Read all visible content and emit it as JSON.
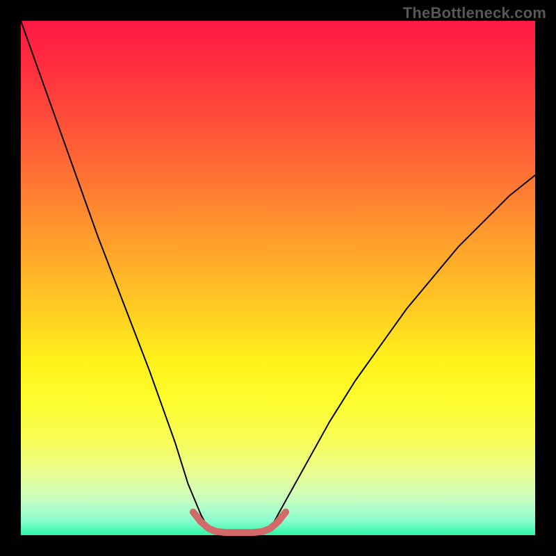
{
  "watermark": "TheBottleneck.com",
  "chart_data": {
    "type": "line",
    "title": "",
    "xlabel": "",
    "ylabel": "",
    "xlim": [
      0,
      100
    ],
    "ylim": [
      0,
      100
    ],
    "grid": false,
    "legend": false,
    "series": [
      {
        "name": "left-curve",
        "x": [
          0,
          5,
          10,
          15,
          20,
          25,
          30,
          32.5,
          35,
          36.5
        ],
        "y": [
          100,
          86,
          72,
          58,
          45,
          32,
          18,
          10,
          4,
          1.2
        ]
      },
      {
        "name": "right-curve",
        "x": [
          48.5,
          50,
          55,
          60,
          65,
          70,
          75,
          80,
          85,
          90,
          95,
          100
        ],
        "y": [
          1.2,
          4,
          13,
          22,
          30,
          37,
          44,
          50,
          56,
          61,
          66,
          70
        ]
      },
      {
        "name": "bottom-u",
        "x": [
          33.5,
          35,
          36.5,
          38,
          40,
          42.5,
          45,
          47,
          48.5,
          50,
          51.5
        ],
        "y": [
          4.5,
          2.6,
          1.3,
          0.7,
          0.5,
          0.5,
          0.5,
          0.7,
          1.3,
          2.6,
          4.5
        ]
      }
    ],
    "styles": {
      "left-curve": {
        "stroke": "#000000",
        "width": 2.0,
        "linecap": "round"
      },
      "right-curve": {
        "stroke": "#000000",
        "width": 2.0,
        "linecap": "round"
      },
      "bottom-u": {
        "stroke": "#d36a6a",
        "width": 10.0,
        "linecap": "round"
      }
    },
    "background_gradient": {
      "top": "#ff1a45",
      "mid": "#fff21a",
      "bottom": "#2bf7a5"
    }
  }
}
